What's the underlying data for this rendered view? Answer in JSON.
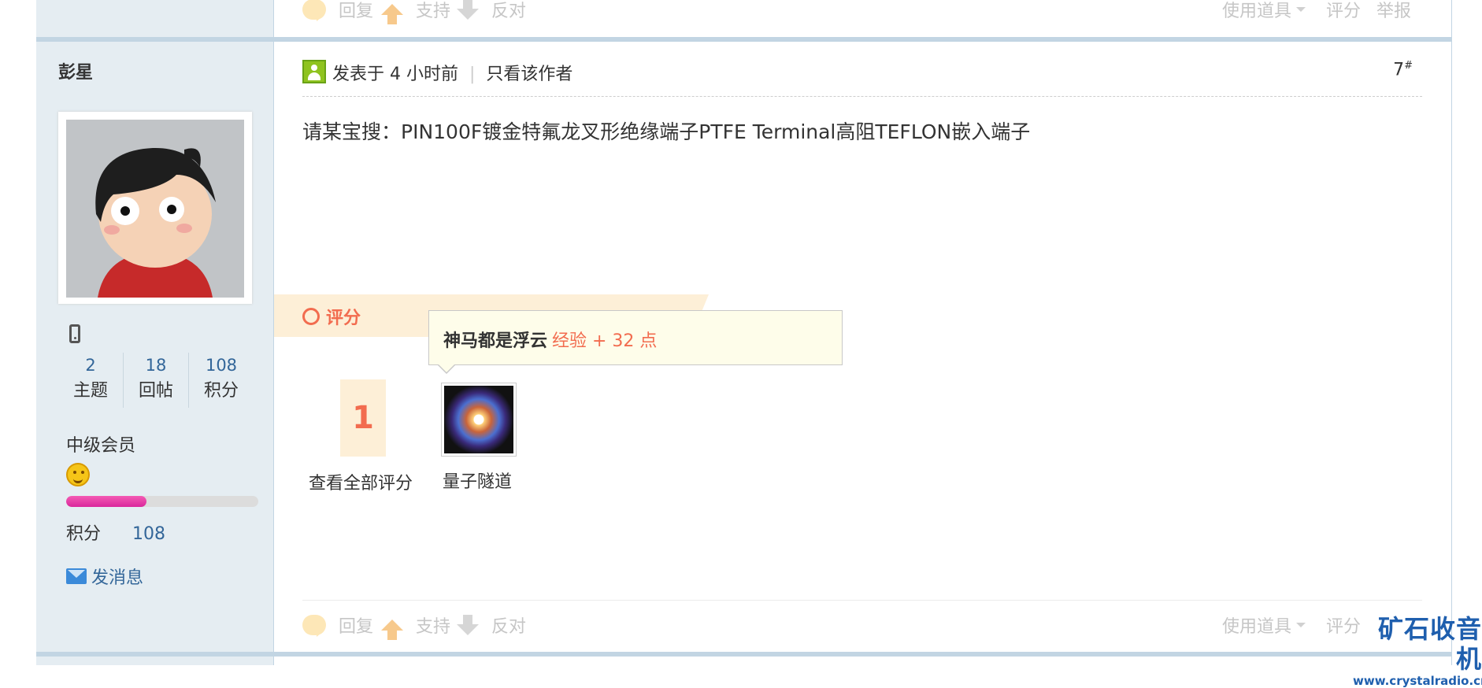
{
  "actions": {
    "reply": "回复",
    "support": "支持",
    "oppose": "反对",
    "tools": "使用道具",
    "rate": "评分",
    "report": "举报"
  },
  "author": {
    "name": "彭星",
    "stats": [
      {
        "value": "2",
        "label": "主题"
      },
      {
        "value": "18",
        "label": "回帖"
      },
      {
        "value": "108",
        "label": "积分"
      }
    ],
    "level": "中级会员",
    "progress_fraction": 0.42,
    "score_label": "积分",
    "score_value": "108",
    "message_label": "发消息"
  },
  "post": {
    "posted": "发表于 4 小时前",
    "separator": "|",
    "only_author": "只看该作者",
    "floor": "7",
    "floor_mark": "#",
    "content": "请某宝搜：PIN100F镀金特氟龙叉形绝缘端子PTFE Terminal高阻TEFLON嵌入端子"
  },
  "rating": {
    "title": "评分",
    "tooltip_user": "神马都是浮云",
    "tooltip_points": "经验 + 32 点",
    "count": "1",
    "view_all": "查看全部评分",
    "rater_name": "量子隧道"
  },
  "watermark": {
    "title": "矿石收音机",
    "url": "www.crystalradio.cn"
  },
  "colors": {
    "link": "#336699",
    "accent": "#f26c4f",
    "sidebar_bg": "#e5edf2",
    "border": "#c2d5e3",
    "watermark": "#1f5fae"
  }
}
